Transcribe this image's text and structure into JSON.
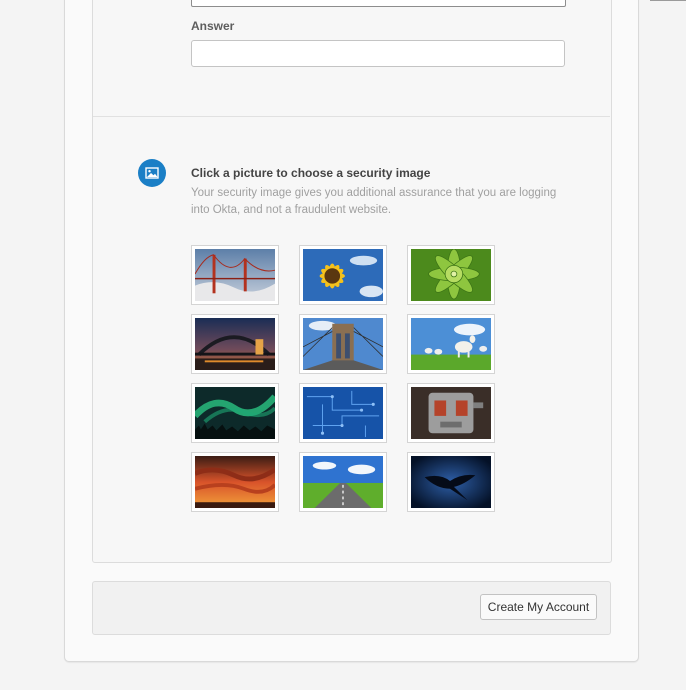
{
  "form": {
    "answer_label": "Answer",
    "answer_value": ""
  },
  "security_image": {
    "title": "Click a picture to choose a security image",
    "description": "Your security image gives you additional assurance that you are logging into Okta, and not a fraudulent website.",
    "icon": "image-icon",
    "images": [
      {
        "subject": "golden-gate-bridge"
      },
      {
        "subject": "sunflower"
      },
      {
        "subject": "green-succulent"
      },
      {
        "subject": "harbour-bridge-night"
      },
      {
        "subject": "brooklyn-bridge"
      },
      {
        "subject": "goats-in-field"
      },
      {
        "subject": "aurora"
      },
      {
        "subject": "circuit-board"
      },
      {
        "subject": "robot"
      },
      {
        "subject": "sunset-clouds"
      },
      {
        "subject": "open-road"
      },
      {
        "subject": "manta-ray"
      }
    ]
  },
  "footer": {
    "create_button_label": "Create My Account"
  },
  "colors": {
    "accent": "#1b7fc6",
    "page_background": "#f4f4f4"
  }
}
